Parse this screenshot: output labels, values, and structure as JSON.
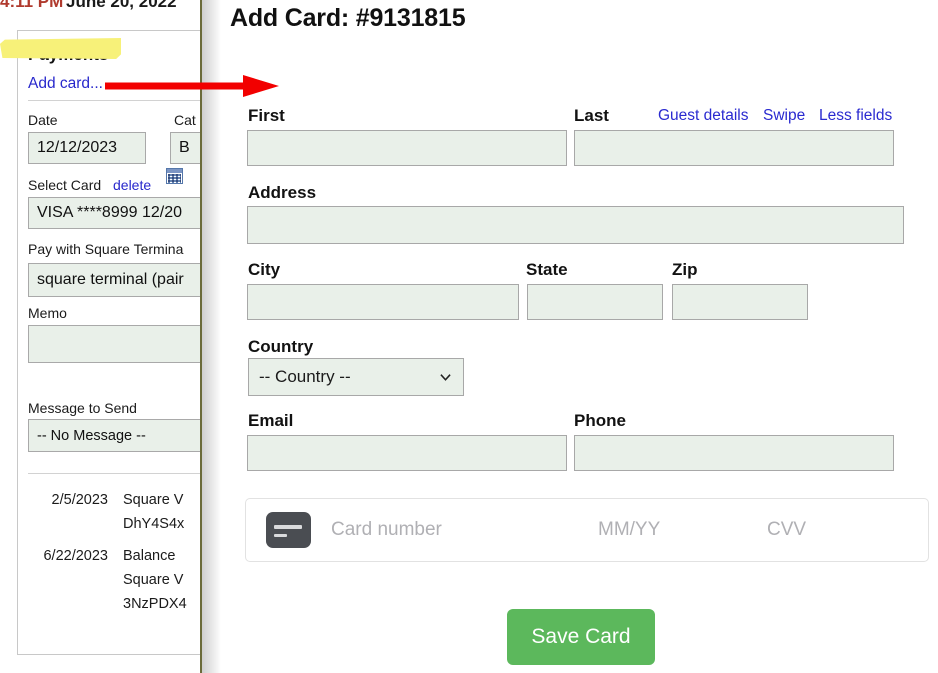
{
  "background_window": {
    "cut_header_left": "4:11 PM",
    "cut_header_right": "June 20, 2022",
    "payments_panel": {
      "title": "Payments",
      "add_card_link": "Add card...",
      "date": {
        "label": "Date",
        "value": "12/12/2023",
        "calendar_icon": "calendar-icon"
      },
      "category": {
        "label": "Cat",
        "value": "B"
      },
      "select_card": {
        "label": "Select Card",
        "delete_link": "delete",
        "value": "VISA ****8999 12/20"
      },
      "pay_with": {
        "label": "Pay with Square Termina",
        "value": "square terminal (pair"
      },
      "memo": {
        "label": "Memo",
        "value": ""
      },
      "message_to_send": {
        "label": "Message to Send",
        "value": "-- No Message --"
      },
      "transactions": [
        {
          "date": "2/5/2023",
          "lines": [
            "Square V",
            "DhY4S4x"
          ]
        },
        {
          "date": "6/22/2023",
          "lines": [
            "Balance",
            "Square V",
            "3NzPDX4"
          ]
        }
      ]
    }
  },
  "annotation": {
    "arrow_color": "#f20000",
    "highlight_color": "#f7f179"
  },
  "modal": {
    "title": "Add Card: #9131815",
    "links": [
      {
        "label": "Guest details"
      },
      {
        "label": "Swipe"
      },
      {
        "label": "Less fields"
      }
    ],
    "fields": {
      "first": {
        "label": "First",
        "value": ""
      },
      "last": {
        "label": "Last",
        "value": ""
      },
      "address": {
        "label": "Address",
        "value": ""
      },
      "city": {
        "label": "City",
        "value": ""
      },
      "state": {
        "label": "State",
        "value": ""
      },
      "zip": {
        "label": "Zip",
        "value": ""
      },
      "country": {
        "label": "Country",
        "selected": "-- Country --"
      },
      "email": {
        "label": "Email",
        "value": ""
      },
      "phone": {
        "label": "Phone",
        "value": ""
      }
    },
    "card_widget": {
      "card_number_placeholder": "Card number",
      "expiry_placeholder": "MM/YY",
      "cvv_placeholder": "CVV"
    },
    "save_button": "Save Card",
    "accent_color": "#5cb85c",
    "link_color": "#2a2ad0",
    "input_background": "#e9f0e9"
  }
}
